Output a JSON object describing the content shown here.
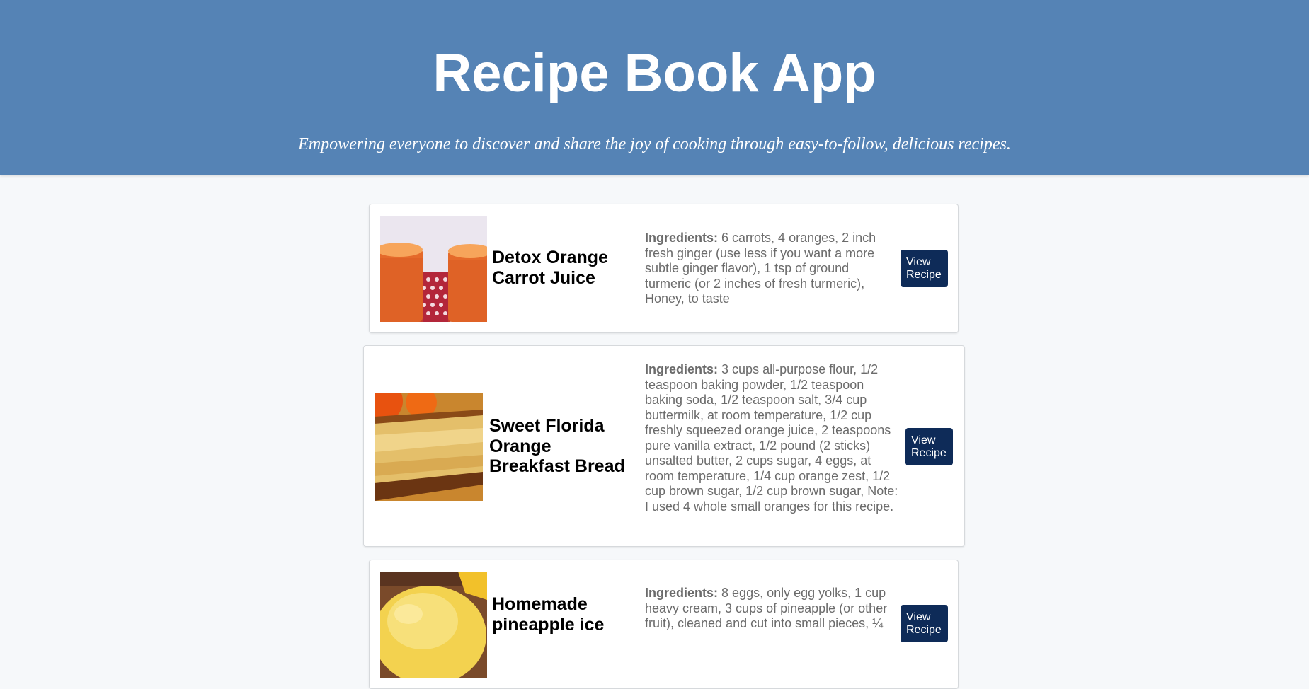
{
  "header": {
    "title": "Recipe Book App",
    "tagline": "Empowering everyone to discover and share the joy of cooking through easy-to-follow, delicious recipes."
  },
  "recipes": [
    {
      "title": "Detox Orange Carrot Juice",
      "ingredients_label": "Ingredients:",
      "ingredients": "6 carrots, 4 oranges, 2 inch fresh ginger (use less if you want a more subtle ginger flavor), 1 tsp of ground turmeric (or 2 inches of fresh turmeric), Honey, to taste",
      "button_label": "View Recipe"
    },
    {
      "title": "Sweet Florida Orange Breakfast Bread",
      "ingredients_label": "Ingredients:",
      "ingredients": "3 cups all-purpose flour, 1/2 teaspoon baking powder, 1/2 teaspoon baking soda, 1/2 teaspoon salt, 3/4 cup buttermilk, at room temperature, 1/2 cup freshly squeezed orange juice, 2 teaspoons pure vanilla extract, 1/2 pound (2 sticks) unsalted butter, 2 cups sugar, 4 eggs, at room temperature, 1/4 cup orange zest, 1/2 cup brown sugar, 1/2 cup brown sugar, Note: I used 4 whole small oranges for this recipe.",
      "button_label": "View Recipe"
    },
    {
      "title": "Homemade pineapple ice",
      "ingredients_label": "Ingredients:",
      "ingredients": "8 eggs, only egg yolks, 1 cup heavy cream, 3 cups of pineapple (or other fruit), cleaned and cut into small pieces, ¼",
      "button_label": "View Recipe"
    }
  ]
}
